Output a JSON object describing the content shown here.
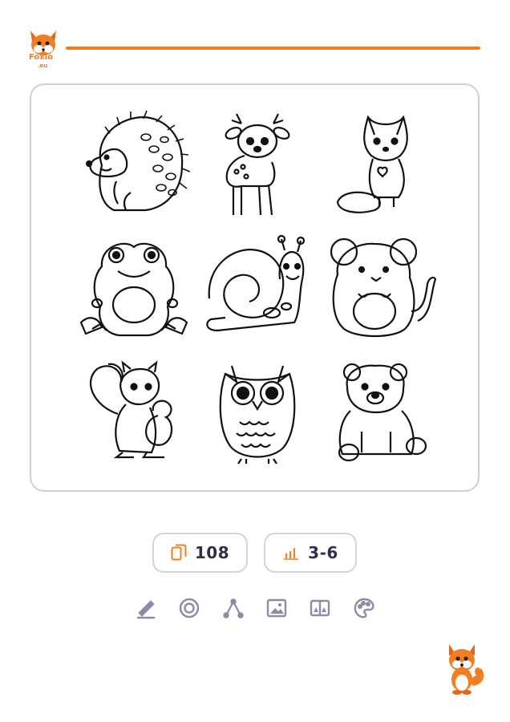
{
  "brand": {
    "name": "Foxio",
    "domain": ".eu",
    "accent": "#f07f23"
  },
  "sheet": {
    "animals": [
      "hedgehog",
      "fawn",
      "fox",
      "frog",
      "snail",
      "mouse",
      "squirrel",
      "owl",
      "bear-cub"
    ]
  },
  "stats": {
    "pages": {
      "icon": "pages-icon",
      "value": "108"
    },
    "age": {
      "icon": "bar-chart-icon",
      "value": "3-6"
    }
  },
  "tools": [
    "pen-icon",
    "target-icon",
    "path-icon",
    "image-icon",
    "compare-icon",
    "palette-icon"
  ]
}
